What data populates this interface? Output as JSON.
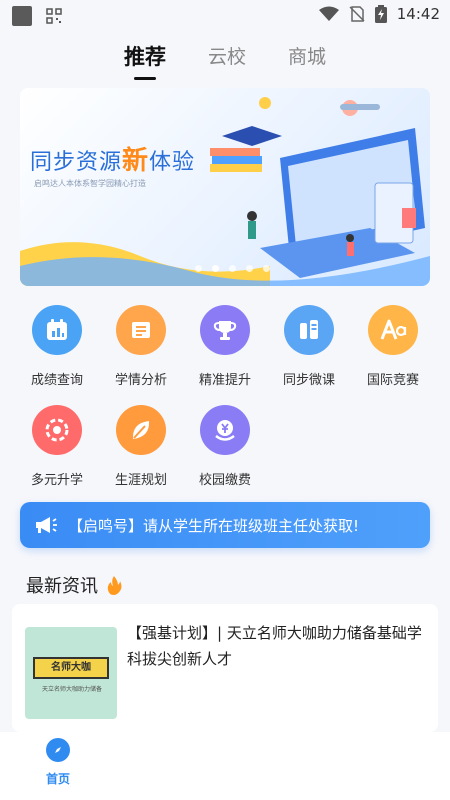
{
  "status_bar": {
    "time": "14:42"
  },
  "tabs": [
    {
      "label": "推荐",
      "active": true
    },
    {
      "label": "云校",
      "active": false
    },
    {
      "label": "商城",
      "active": false
    }
  ],
  "banner": {
    "title_part1": "同步资源",
    "title_accent": "新",
    "title_part2": "体验",
    "subtitle": "启鸣达人本体系智学园精心打造"
  },
  "features": [
    {
      "label": "成绩查询",
      "icon": "calendar-chart-icon",
      "color": "#4aa3f5"
    },
    {
      "label": "学情分析",
      "icon": "book-icon",
      "color": "#ffa64d"
    },
    {
      "label": "精准提升",
      "icon": "trophy-icon",
      "color": "#8b7cf6"
    },
    {
      "label": "同步微课",
      "icon": "bars-icon",
      "color": "#5aa6f5"
    },
    {
      "label": "国际竞赛",
      "icon": "letter-a-icon",
      "color": "#ffb547"
    },
    {
      "label": "多元升学",
      "icon": "target-icon",
      "color": "#ff6b6b"
    },
    {
      "label": "生涯规划",
      "icon": "leaf-icon",
      "color": "#ff9a3d"
    },
    {
      "label": "校园缴费",
      "icon": "yen-coin-icon",
      "color": "#8a7cf5"
    }
  ],
  "notice": {
    "text": "【启鸣号】请从学生所在班级班主任处获取!",
    "icon": "megaphone-icon"
  },
  "news_section": {
    "title": "最新资讯",
    "icon": "fire-icon"
  },
  "news": [
    {
      "title": "【强基计划】| 天立名师大咖助力储备基础学科拔尖创新人才",
      "thumb_title": "名师大咖",
      "thumb_caption": "天立名师大咖助力储备"
    }
  ],
  "bottom_nav": {
    "home_label": "首页",
    "icon": "compass-icon",
    "color": "#2f8bf0"
  }
}
